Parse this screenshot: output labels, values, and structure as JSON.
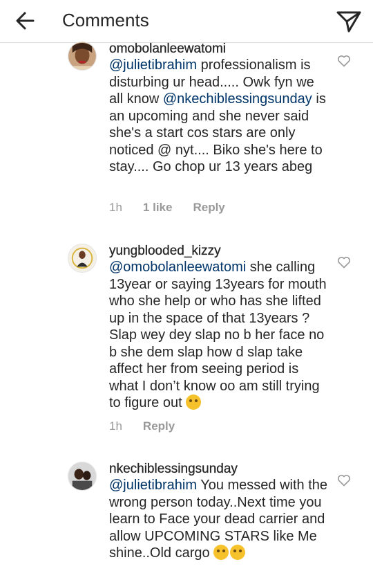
{
  "header": {
    "title": "Comments",
    "back_icon": "arrow-left-icon",
    "send_icon": "paper-plane-icon"
  },
  "comments": [
    {
      "username": "omobolanleewatomi",
      "mention": "@julietibrahim",
      "text": " professionalism is disturbing ur head..... Owk fyn we all know ",
      "mention2": "@nkechiblessingsunday",
      "text2": " is an upcoming and she never said she's a start cos stars are only noticed @ nyt.... Biko she's here to stay.... Go chop ur 13 years abeg",
      "time": "1h",
      "likes": "1 like",
      "reply": "Reply"
    },
    {
      "username": "yungblooded_kizzy",
      "mention": "@omobolanleewatomi",
      "text": " she calling 13year or saying 13years for mouth who she help or who has she lifted up in the space of that 13years ? Slap wey dey slap no b her face no b she dem slap how d slap take affect her from seeing period is what I don’t know oo am still trying to figure out ",
      "emoji": "thinking-face-emoji",
      "time": "1h",
      "reply": "Reply"
    },
    {
      "username": "nkechiblessingsunday",
      "mention": "@julietibrahim",
      "text": " You messed with the wrong person today..Next time you learn to Face your dead carrier and allow UPCOMING STARS like Me shine..Old cargo ",
      "emoji": "rolling-on-floor-laughing-emoji"
    }
  ],
  "colors": {
    "mention": "#003569",
    "meta": "#999999",
    "text": "#262626",
    "divider": "#dbdbdb"
  }
}
